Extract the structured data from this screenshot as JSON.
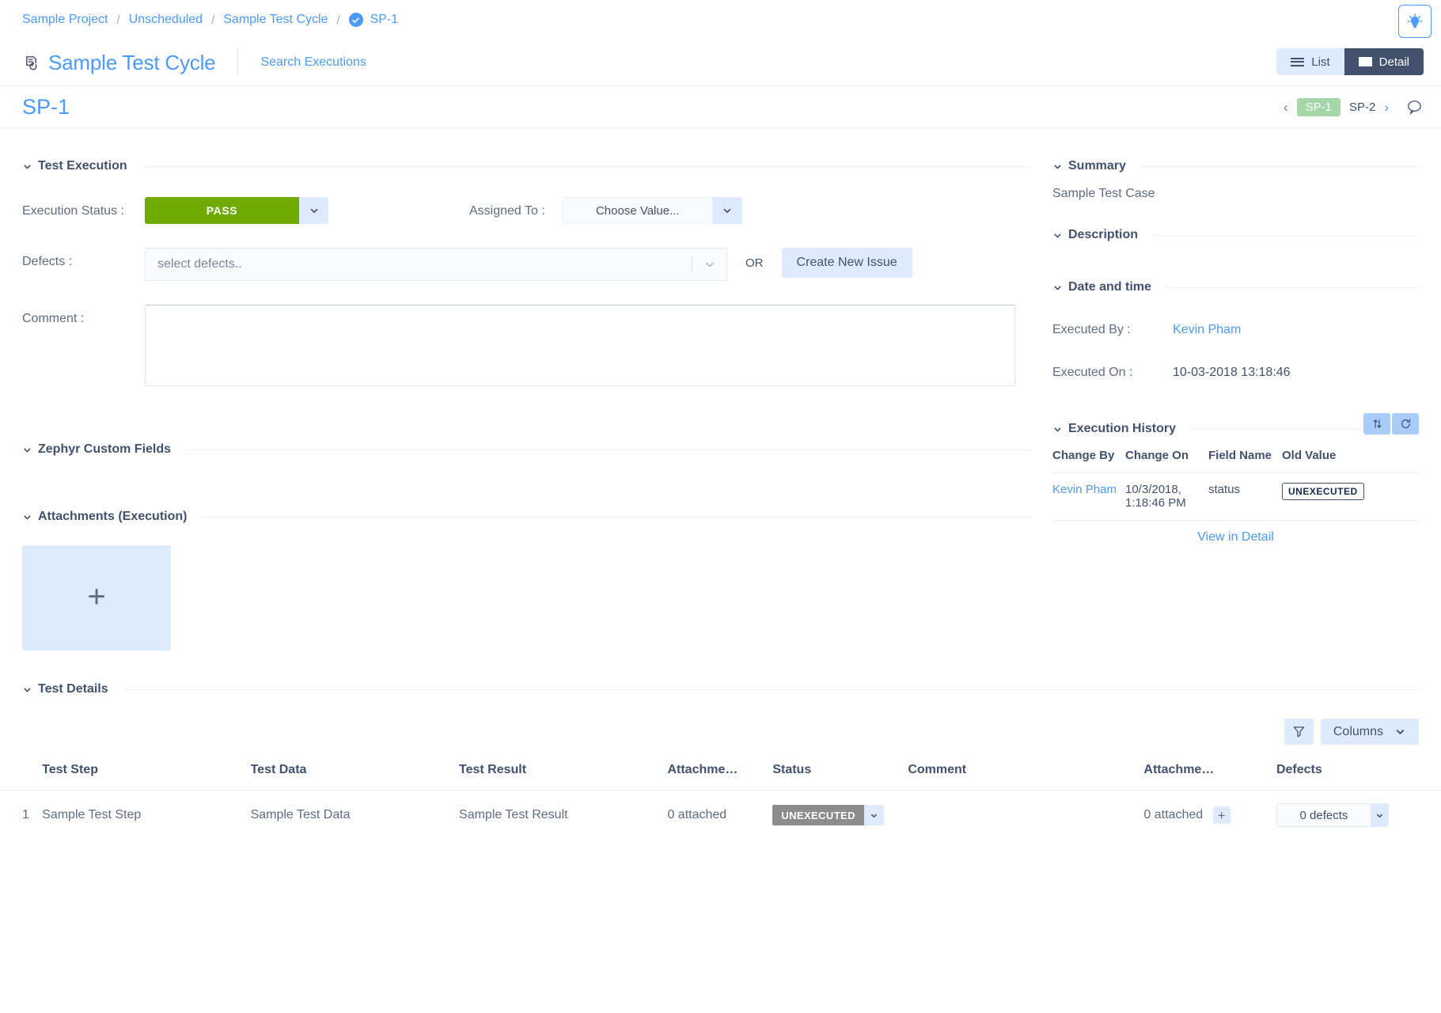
{
  "breadcrumb": {
    "items": [
      {
        "label": "Sample Project"
      },
      {
        "label": "Unscheduled"
      },
      {
        "label": "Sample Test Cycle"
      },
      {
        "label": "SP-1"
      }
    ],
    "separator": "/"
  },
  "header": {
    "cycle_title": "Sample Test Cycle",
    "search_executions": "Search Executions",
    "view_list": "List",
    "view_detail": "Detail"
  },
  "issue": {
    "key": "SP-1",
    "prev_arrow": "‹",
    "next_arrow": "›",
    "nav_current": "SP-1",
    "nav_next": "SP-2"
  },
  "test_execution": {
    "section_title": "Test Execution",
    "execution_status_label": "Execution Status :",
    "execution_status_value": "PASS",
    "execution_status_color": "#6eaa00",
    "assigned_to_label": "Assigned To :",
    "assigned_to_value": "Choose Value...",
    "defects_label": "Defects :",
    "defects_placeholder": "select defects..",
    "or_text": "OR",
    "create_new_issue": "Create New Issue",
    "comment_label": "Comment :",
    "comment_value": ""
  },
  "zephyr_custom_fields": {
    "section_title": "Zephyr Custom Fields"
  },
  "attachments_execution": {
    "section_title": "Attachments (Execution)",
    "add_glyph": "+"
  },
  "summary": {
    "section_title": "Summary",
    "value": "Sample Test Case"
  },
  "description": {
    "section_title": "Description"
  },
  "date_and_time": {
    "section_title": "Date and time",
    "executed_by_label": "Executed By :",
    "executed_by_value": "Kevin Pham",
    "executed_on_label": "Executed On :",
    "executed_on_value": "10-03-2018 13:18:46"
  },
  "execution_history": {
    "section_title": "Execution History",
    "columns": [
      "Change By",
      "Change On",
      "Field Name",
      "Old Value"
    ],
    "rows": [
      {
        "change_by": "Kevin Pham",
        "change_on": "10/3/2018, 1:18:46 PM",
        "field_name": "status",
        "old_value": "UNEXECUTED"
      }
    ],
    "view_in_detail": "View in Detail"
  },
  "test_details": {
    "section_title": "Test Details",
    "columns_button": "Columns",
    "columns": [
      "",
      "Test Step",
      "Test Data",
      "Test Result",
      "Attachme…",
      "Status",
      "Comment",
      "Attachme…",
      "Defects"
    ],
    "rows": [
      {
        "index": "1",
        "test_step": "Sample Test Step",
        "test_data": "Sample Test Data",
        "test_result": "Sample Test Result",
        "attachments_1": "0 attached",
        "status": "UNEXECUTED",
        "comment": "",
        "attachments_2": "0 attached",
        "attachments_2_add": "+",
        "defects": "0 defects"
      }
    ]
  },
  "colors": {
    "link": "#4c9aff",
    "text": "#42526e",
    "accent_light": "#deebff",
    "pass_green": "#6eaa00",
    "chip_green": "#a5d6a7",
    "unexecuted_gray": "#8c8c8c"
  }
}
